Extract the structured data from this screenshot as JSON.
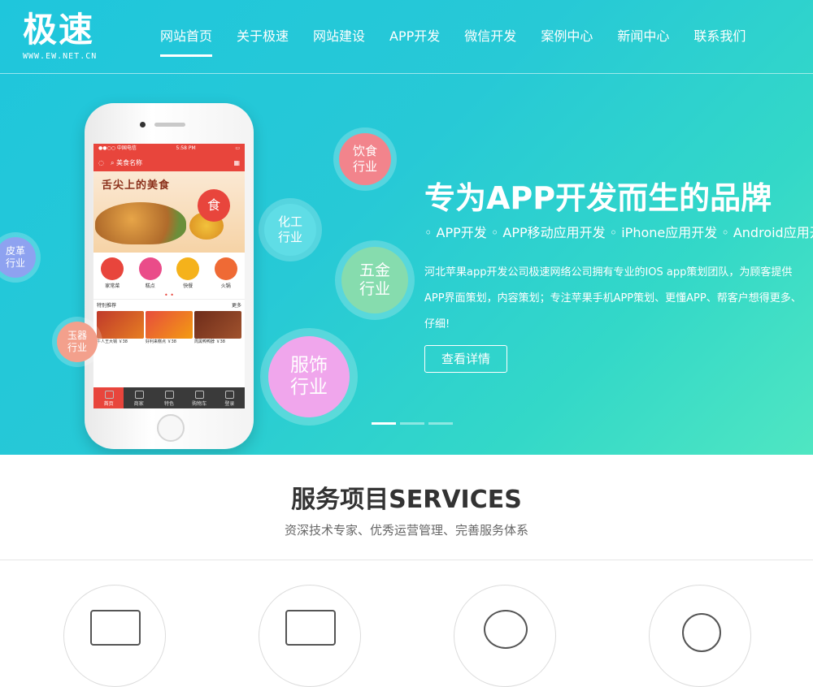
{
  "logo": {
    "main": "极速",
    "sub": "WWW.EW.NET.CN"
  },
  "nav": {
    "items": [
      {
        "label": "网站首页",
        "active": true
      },
      {
        "label": "关于极速"
      },
      {
        "label": "网站建设"
      },
      {
        "label": "APP开发"
      },
      {
        "label": "微信开发"
      },
      {
        "label": "案例中心"
      },
      {
        "label": "新闻中心"
      },
      {
        "label": "联系我们"
      }
    ]
  },
  "phone": {
    "status_carrier": "●●○○ 中国电信",
    "status_time": "5:58 PM",
    "search_label": "美食名称",
    "banner_title": "舌尖上的美食",
    "banner_badge": "食",
    "categories": [
      {
        "label": "家常菜",
        "color": "#e8453c"
      },
      {
        "label": "糕点",
        "color": "#ea4c89"
      },
      {
        "label": "快餐",
        "color": "#f5b21b"
      },
      {
        "label": "火锅",
        "color": "#ef6a35"
      }
    ],
    "recommend_label": "特别推荐",
    "recommend_more": "更多",
    "items": [
      {
        "label": "牛人王大锅 ￥38"
      },
      {
        "label": "好利来糕点 ￥38"
      },
      {
        "label": "周黑鸭鸭脖 ￥38"
      }
    ],
    "tabs": [
      {
        "label": "首页",
        "active": true
      },
      {
        "label": "商家"
      },
      {
        "label": "特色"
      },
      {
        "label": "购物车"
      },
      {
        "label": "登录"
      }
    ]
  },
  "bubbles": {
    "yinshi": "饮食\n行业",
    "huagong": "化工\n行业",
    "wujin": "五金\n行业",
    "fushi": "服饰\n行业",
    "pige": "皮革\n行业",
    "yudong": "玉器\n行业"
  },
  "hero": {
    "headline": "专为APP开发而生的品牌",
    "tagline": "◦ APP开发 ◦ APP移动应用开发 ◦ iPhone应用开发 ◦ Android应用开发",
    "desc_lines": [
      "河北苹果app开发公司极速网络公司拥有专业的IOS app策划团队，为顾客提供",
      "APP界面策划，内容策划；专注苹果手机APP策划、更懂APP、帮客户想得更多、",
      "仔细!"
    ],
    "button_label": "查看详情"
  },
  "services": {
    "title": "服务项目SERVICES",
    "subtitle": "资深技术专家、优秀运营管理、完善服务体系"
  },
  "colors": {
    "accent_red": "#e8453c",
    "hero_teal": "#1fc6dc"
  }
}
